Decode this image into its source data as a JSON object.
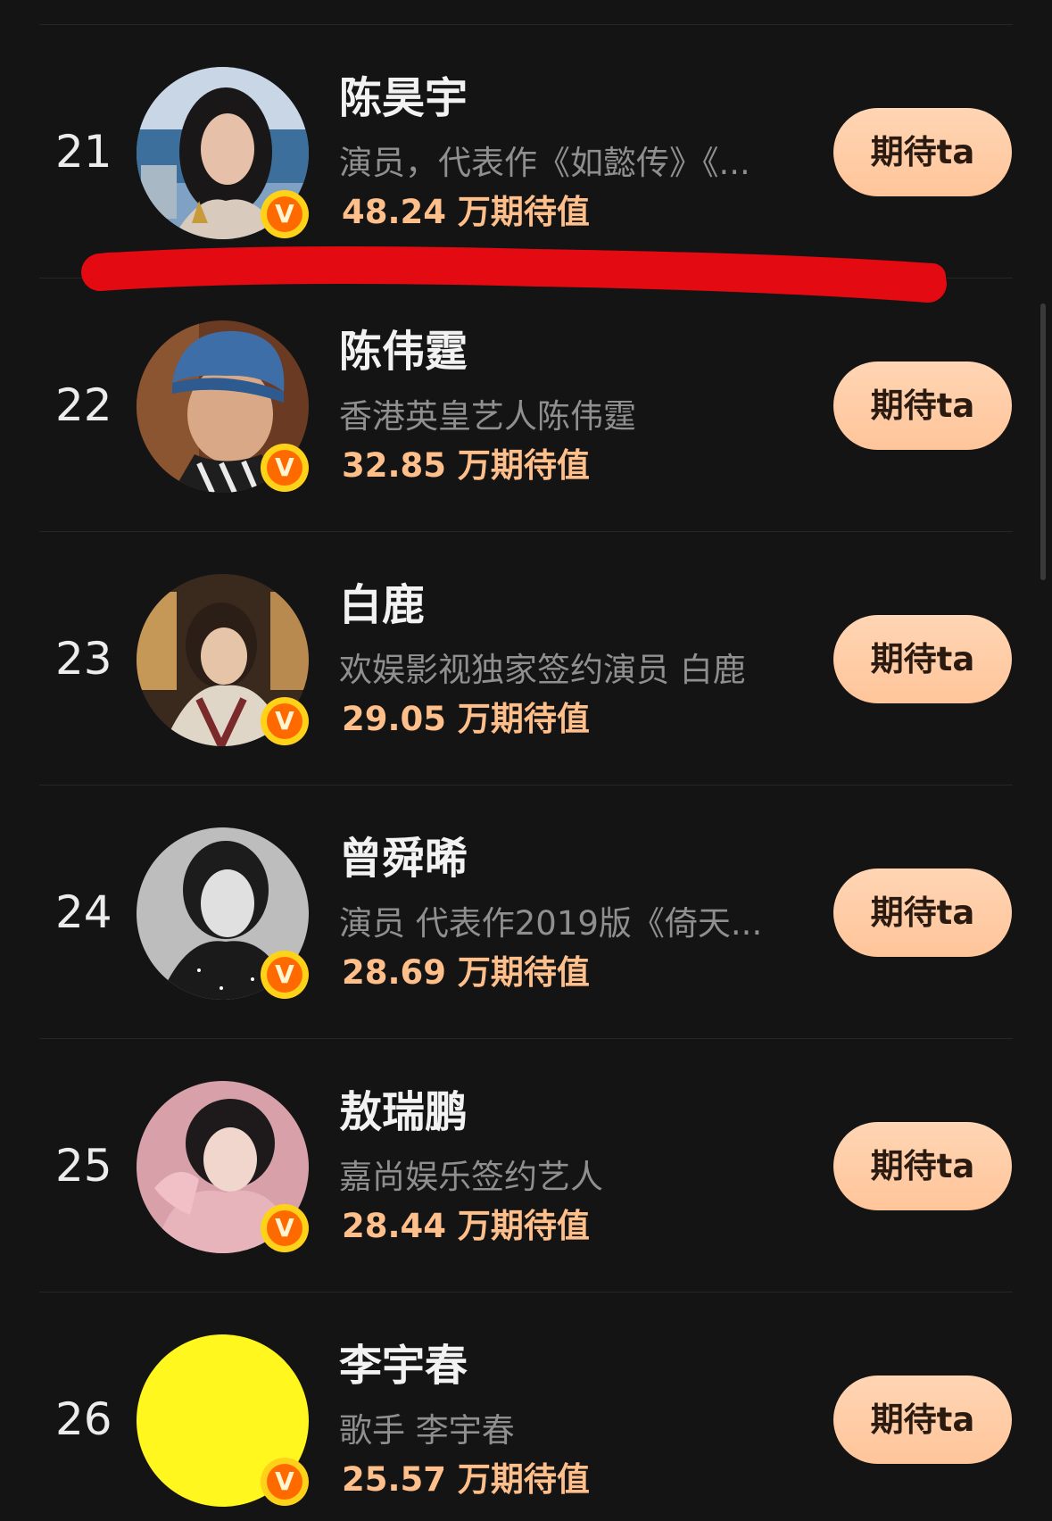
{
  "colors": {
    "background": "#141414",
    "name_text": "#f2f2f2",
    "desc_text": "#8f8f8f",
    "score_text": "#ffbf8a",
    "button_bg": "#ffc9a0",
    "button_text": "#2a1a10",
    "verified_badge": "#ff6a00",
    "red_annotation": "#e30a12",
    "yellow_cover": "#fff71e"
  },
  "icons": {
    "verified": "v-verified-badge-icon"
  },
  "rows": [
    {
      "rank": "21",
      "name": "陈昊宇",
      "desc": "演员，代表作《如懿传》《...",
      "score_value": "48.24",
      "score_suffix": " 万期待值",
      "button": "期待ta",
      "badge": "V"
    },
    {
      "rank": "22",
      "name": "陈伟霆",
      "desc": "香港英皇艺人陈伟霆",
      "score_value": "32.85",
      "score_suffix": " 万期待值",
      "button": "期待ta",
      "badge": "V"
    },
    {
      "rank": "23",
      "name": "白鹿",
      "desc": "欢娱影视独家签约演员 白鹿",
      "score_value": "29.05",
      "score_suffix": " 万期待值",
      "button": "期待ta",
      "badge": "V"
    },
    {
      "rank": "24",
      "name": "曾舜晞",
      "desc": "演员 代表作2019版《倚天...",
      "score_value": "28.69",
      "score_suffix": " 万期待值",
      "button": "期待ta",
      "badge": "V"
    },
    {
      "rank": "25",
      "name": "敖瑞鹏",
      "desc": "嘉尚娱乐签约艺人",
      "score_value": "28.44",
      "score_suffix": " 万期待值",
      "button": "期待ta",
      "badge": "V"
    },
    {
      "rank": "26",
      "name": "李宇春",
      "desc": "歌手 李宇春",
      "score_value": "25.57",
      "score_suffix": " 万期待值",
      "button": "期待ta",
      "badge": "V"
    }
  ]
}
